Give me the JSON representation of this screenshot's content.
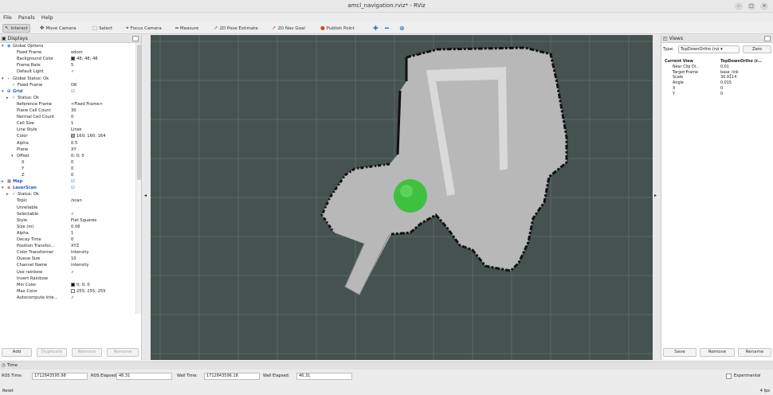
{
  "window": {
    "title": "amcl_navigation.rviz* - RViz"
  },
  "menu": [
    "File",
    "Panels",
    "Help"
  ],
  "toolbar": {
    "tools": [
      {
        "label": "Interact",
        "icon": "interact-icon",
        "glyph": "↖"
      },
      {
        "label": "Move Camera",
        "icon": "move-camera-icon",
        "glyph": "✥"
      },
      {
        "label": "Select",
        "icon": "select-icon",
        "glyph": "⬚"
      },
      {
        "label": "Focus Camera",
        "icon": "focus-camera-icon",
        "glyph": "⌖"
      },
      {
        "label": "Measure",
        "icon": "measure-icon",
        "glyph": "═"
      },
      {
        "label": "2D Pose Estimate",
        "icon": "pose-estimate-icon",
        "glyph": "➚",
        "color": "#2ea52e"
      },
      {
        "label": "2D Nav Goal",
        "icon": "nav-goal-icon",
        "glyph": "➚",
        "color": "#c83ec8"
      },
      {
        "label": "Publish Point",
        "icon": "publish-point-icon",
        "glyph": "●",
        "color": "#d0461e"
      }
    ],
    "extra_icons": [
      "plus-icon",
      "minus-icon",
      "crosshair-icon"
    ]
  },
  "displays": {
    "title": "Displays",
    "tree": [
      {
        "label": "Global Options",
        "value": "",
        "indent": 0,
        "arrow": "▾",
        "icon": "◉",
        "icon_color": "#3a7bd5"
      },
      {
        "label": "Fixed Frame",
        "value": "odom",
        "indent": 2
      },
      {
        "label": "Background Color",
        "value": "48; 48; 48",
        "indent": 2,
        "swatch": "#303030"
      },
      {
        "label": "Frame Rate",
        "value": "5",
        "indent": 2
      },
      {
        "label": "Default Light",
        "value": "✓",
        "indent": 2
      },
      {
        "label": "Global Status: Ok",
        "value": "",
        "indent": 0,
        "arrow": "▾",
        "icon": "✓",
        "icon_color": "#2a9d2a"
      },
      {
        "label": "Fixed Frame",
        "value": "OK",
        "indent": 1,
        "icon": "✓",
        "icon_color": "#2a9d2a"
      },
      {
        "label": "Grid",
        "value": "☑",
        "indent": 0,
        "arrow": "▾",
        "icon": "⊞",
        "icon_color": "#2a6fbf",
        "selected": true
      },
      {
        "label": "Status: Ok",
        "value": "",
        "indent": 1,
        "arrow": "▸",
        "icon": "✓",
        "icon_color": "#2a9d2a"
      },
      {
        "label": "Reference Frame",
        "value": "<Fixed Frame>",
        "indent": 2
      },
      {
        "label": "Plane Cell Count",
        "value": "30",
        "indent": 2
      },
      {
        "label": "Normal Cell Count",
        "value": "0",
        "indent": 2
      },
      {
        "label": "Cell Size",
        "value": "1",
        "indent": 2
      },
      {
        "label": "Line Style",
        "value": "Lines",
        "indent": 2
      },
      {
        "label": "Color",
        "value": "160; 160; 164",
        "indent": 2,
        "swatch": "#a0a0a4"
      },
      {
        "label": "Alpha",
        "value": "0.5",
        "indent": 2
      },
      {
        "label": "Plane",
        "value": "XY",
        "indent": 2
      },
      {
        "label": "Offset",
        "value": "0; 0; 0",
        "indent": 2,
        "arrow": "▾"
      },
      {
        "label": "X",
        "value": "0",
        "indent": 3
      },
      {
        "label": "Y",
        "value": "0",
        "indent": 3
      },
      {
        "label": "Z",
        "value": "0",
        "indent": 3
      },
      {
        "label": "Map",
        "value": "☑",
        "indent": 0,
        "arrow": "▸",
        "icon": "▦",
        "icon_color": "#555555",
        "selected": true
      },
      {
        "label": "LaserScan",
        "value": "☑",
        "indent": 0,
        "arrow": "▾",
        "icon": "≋",
        "icon_color": "#c0392b",
        "selected": true
      },
      {
        "label": "Status: Ok",
        "value": "",
        "indent": 1,
        "arrow": "▸",
        "icon": "✓",
        "icon_color": "#2a9d2a"
      },
      {
        "label": "Topic",
        "value": "/scan",
        "indent": 2
      },
      {
        "label": "Unreliable",
        "value": "",
        "indent": 2
      },
      {
        "label": "Selectable",
        "value": "✓",
        "indent": 2
      },
      {
        "label": "Style",
        "value": "Flat Squares",
        "indent": 2
      },
      {
        "label": "Size (m)",
        "value": "0.06",
        "indent": 2
      },
      {
        "label": "Alpha",
        "value": "1",
        "indent": 2
      },
      {
        "label": "Decay Time",
        "value": "0",
        "indent": 2
      },
      {
        "label": "Position Transfor...",
        "value": "XYZ",
        "indent": 2
      },
      {
        "label": "Color Transformer",
        "value": "Intensity",
        "indent": 2
      },
      {
        "label": "Queue Size",
        "value": "10",
        "indent": 2
      },
      {
        "label": "Channel Name",
        "value": "intensity",
        "indent": 2
      },
      {
        "label": "Use rainbow",
        "value": "✓",
        "indent": 2
      },
      {
        "label": "Invert Rainbow",
        "value": "",
        "indent": 2
      },
      {
        "label": "Min Color",
        "value": "0; 0; 0",
        "indent": 2,
        "swatch": "#000000"
      },
      {
        "label": "Max Color",
        "value": "255; 255; 255",
        "indent": 2,
        "swatch": "#ffffff"
      },
      {
        "label": "Autocompute Inte...",
        "value": "✓",
        "indent": 2
      }
    ],
    "buttons": [
      "Add",
      "Duplicate",
      "Remove",
      "Rename"
    ]
  },
  "views": {
    "title": "Views",
    "type_label": "Type:",
    "type_value": "TopDownOrtho (rvi ▾",
    "zero_button": "Zero",
    "rows": [
      {
        "label": "Current View",
        "value": "TopDownOrtho (r...",
        "bold": true,
        "arrow": "▾"
      },
      {
        "label": "Near Clip Di...",
        "value": "0.01"
      },
      {
        "label": "Target Frame",
        "value": "base_link"
      },
      {
        "label": "Scale",
        "value": "30.9114"
      },
      {
        "label": "Angle",
        "value": "0.015"
      },
      {
        "label": "X",
        "value": "0"
      },
      {
        "label": "Y",
        "value": "0"
      }
    ],
    "buttons": [
      "Save",
      "Remove",
      "Rename"
    ]
  },
  "time": {
    "title": "Time",
    "ros_time_label": "ROS Time:",
    "ros_time": "1712843595.98",
    "ros_elapsed_label": "ROS Elapsed:",
    "ros_elapsed": "46.31",
    "wall_time_label": "Wall Time:",
    "wall_time": "1712843596.18",
    "wall_elapsed_label": "Wall Elapsed:",
    "wall_elapsed": "46.31",
    "experimental": "Experimental"
  },
  "status": {
    "left": "Reset",
    "right": "4 fps"
  },
  "colors": {
    "viewport_bg": "#45524f",
    "robot": "#3fc13f",
    "map_free": "#b8b8b8"
  }
}
